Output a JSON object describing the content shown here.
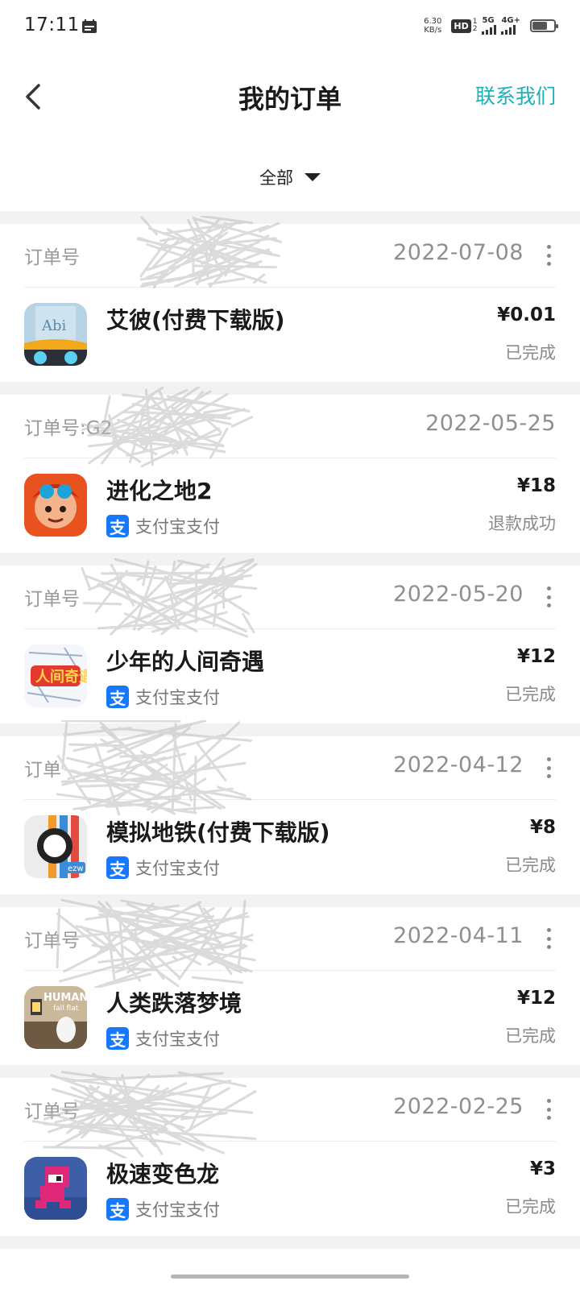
{
  "status_bar": {
    "time": "17:11",
    "net_speed_value": "6.30",
    "net_speed_unit": "KB/s",
    "hd_label": "HD",
    "hd_sim1": "1",
    "hd_sim2": "2",
    "signal1_label": "5G",
    "signal2_label": "4G+",
    "battery_level": 0.7,
    "icons": [
      "calendar-icon",
      "signal-icon",
      "battery-icon"
    ]
  },
  "header": {
    "title": "我的订单",
    "contact_label": "联系我们",
    "accent_color": "#1bb1b8"
  },
  "filter": {
    "selected": "全部"
  },
  "orders": [
    {
      "order_no_label": "订单号",
      "date": "2022-07-08",
      "has_more": true,
      "app_name": "艾彼(付费下载版)",
      "price": "¥0.01",
      "status": "已完成",
      "pay_method": "",
      "icon": "abi-app-icon"
    },
    {
      "order_no_label": "订单号:G2",
      "date": "2022-05-25",
      "has_more": false,
      "app_name": "进化之地2",
      "price": "¥18",
      "status": "退款成功",
      "pay_method": "支付宝支付",
      "icon": "evoland2-app-icon"
    },
    {
      "order_no_label": "订单号",
      "date": "2022-05-20",
      "has_more": true,
      "app_name": "少年的人间奇遇",
      "price": "¥12",
      "status": "已完成",
      "pay_method": "支付宝支付",
      "icon": "youth-adventure-app-icon"
    },
    {
      "order_no_label": "订单",
      "date": "2022-04-12",
      "has_more": true,
      "app_name": "模拟地铁(付费下载版)",
      "price": "¥8",
      "status": "已完成",
      "pay_method": "支付宝支付",
      "icon": "mini-metro-app-icon"
    },
    {
      "order_no_label": "订单号",
      "date": "2022-04-11",
      "has_more": true,
      "app_name": "人类跌落梦境",
      "price": "¥12",
      "status": "已完成",
      "pay_method": "支付宝支付",
      "icon": "human-fall-flat-app-icon"
    },
    {
      "order_no_label": "订单号",
      "date": "2022-02-25",
      "has_more": true,
      "app_name": "极速变色龙",
      "price": "¥3",
      "status": "已完成",
      "pay_method": "支付宝支付",
      "icon": "chameleon-run-app-icon"
    }
  ],
  "alipay_glyph": "支"
}
